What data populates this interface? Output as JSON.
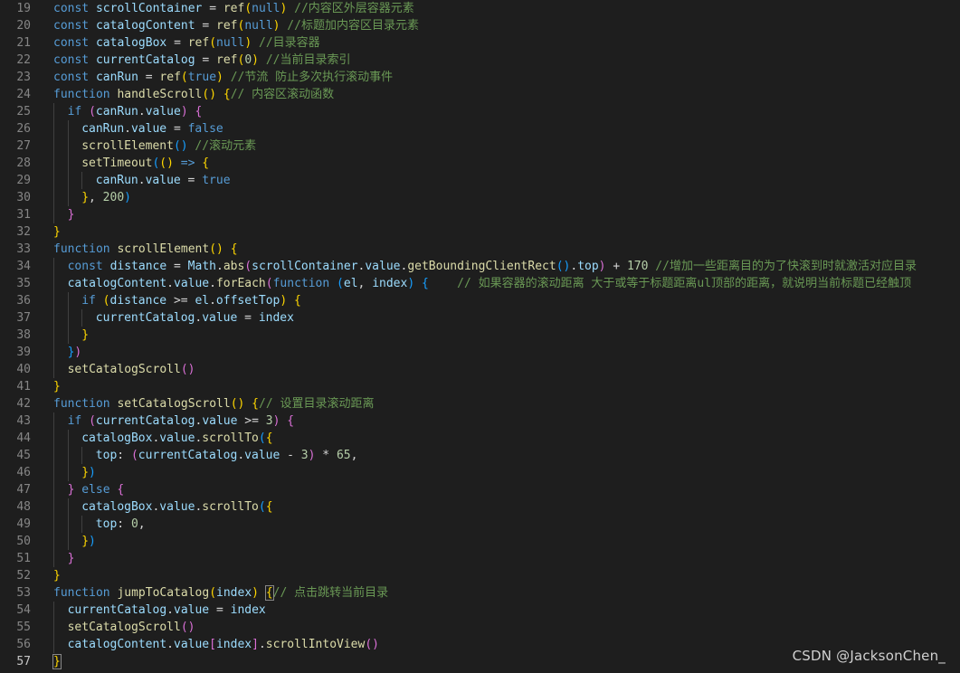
{
  "editor": {
    "current_line": 57,
    "lines": [
      {
        "n": 19,
        "indent": 0,
        "tokens": [
          [
            "kw",
            "const "
          ],
          [
            "var",
            "scrollContainer"
          ],
          [
            "op",
            " = "
          ],
          [
            "fn",
            "ref"
          ],
          [
            "b1",
            "("
          ],
          [
            "kw",
            "null"
          ],
          [
            "b1",
            ")"
          ],
          [
            "com",
            " //内容区外层容器元素"
          ]
        ]
      },
      {
        "n": 20,
        "indent": 0,
        "tokens": [
          [
            "kw",
            "const "
          ],
          [
            "var",
            "catalogContent"
          ],
          [
            "op",
            " = "
          ],
          [
            "fn",
            "ref"
          ],
          [
            "b1",
            "("
          ],
          [
            "kw",
            "null"
          ],
          [
            "b1",
            ")"
          ],
          [
            "com",
            " //标题加内容区目录元素"
          ]
        ]
      },
      {
        "n": 21,
        "indent": 0,
        "tokens": [
          [
            "kw",
            "const "
          ],
          [
            "var",
            "catalogBox"
          ],
          [
            "op",
            " = "
          ],
          [
            "fn",
            "ref"
          ],
          [
            "b1",
            "("
          ],
          [
            "kw",
            "null"
          ],
          [
            "b1",
            ")"
          ],
          [
            "com",
            " //目录容器"
          ]
        ]
      },
      {
        "n": 22,
        "indent": 0,
        "tokens": [
          [
            "kw",
            "const "
          ],
          [
            "var",
            "currentCatalog"
          ],
          [
            "op",
            " = "
          ],
          [
            "fn",
            "ref"
          ],
          [
            "b1",
            "("
          ],
          [
            "num",
            "0"
          ],
          [
            "b1",
            ")"
          ],
          [
            "com",
            " //当前目录索引"
          ]
        ]
      },
      {
        "n": 23,
        "indent": 0,
        "tokens": [
          [
            "kw",
            "const "
          ],
          [
            "var",
            "canRun"
          ],
          [
            "op",
            " = "
          ],
          [
            "fn",
            "ref"
          ],
          [
            "b1",
            "("
          ],
          [
            "kw",
            "true"
          ],
          [
            "b1",
            ")"
          ],
          [
            "com",
            " //节流 防止多次执行滚动事件"
          ]
        ]
      },
      {
        "n": 24,
        "indent": 0,
        "tokens": [
          [
            "kw",
            "function "
          ],
          [
            "fn",
            "handleScroll"
          ],
          [
            "b1",
            "()"
          ],
          [
            "op",
            " "
          ],
          [
            "b1",
            "{"
          ],
          [
            "com",
            "// 内容区滚动函数"
          ]
        ]
      },
      {
        "n": 25,
        "indent": 1,
        "tokens": [
          [
            "kw",
            "if "
          ],
          [
            "b2",
            "("
          ],
          [
            "var",
            "canRun"
          ],
          [
            "op",
            "."
          ],
          [
            "var",
            "value"
          ],
          [
            "b2",
            ")"
          ],
          [
            "op",
            " "
          ],
          [
            "b2",
            "{"
          ]
        ]
      },
      {
        "n": 26,
        "indent": 2,
        "tokens": [
          [
            "var",
            "canRun"
          ],
          [
            "op",
            "."
          ],
          [
            "var",
            "value"
          ],
          [
            "op",
            " = "
          ],
          [
            "kw",
            "false"
          ]
        ]
      },
      {
        "n": 27,
        "indent": 2,
        "tokens": [
          [
            "fn",
            "scrollElement"
          ],
          [
            "b3",
            "()"
          ],
          [
            "com",
            " //滚动元素"
          ]
        ]
      },
      {
        "n": 28,
        "indent": 2,
        "tokens": [
          [
            "fn",
            "setTimeout"
          ],
          [
            "b3",
            "("
          ],
          [
            "b1",
            "()"
          ],
          [
            "op",
            " "
          ],
          [
            "kw",
            "=>"
          ],
          [
            "op",
            " "
          ],
          [
            "b1",
            "{"
          ]
        ]
      },
      {
        "n": 29,
        "indent": 3,
        "tokens": [
          [
            "var",
            "canRun"
          ],
          [
            "op",
            "."
          ],
          [
            "var",
            "value"
          ],
          [
            "op",
            " = "
          ],
          [
            "kw",
            "true"
          ]
        ]
      },
      {
        "n": 30,
        "indent": 2,
        "tokens": [
          [
            "b1",
            "}"
          ],
          [
            "op",
            ", "
          ],
          [
            "num",
            "200"
          ],
          [
            "b3",
            ")"
          ]
        ]
      },
      {
        "n": 31,
        "indent": 1,
        "tokens": [
          [
            "b2",
            "}"
          ]
        ]
      },
      {
        "n": 32,
        "indent": 0,
        "tokens": [
          [
            "b1",
            "}"
          ]
        ]
      },
      {
        "n": 33,
        "indent": 0,
        "tokens": [
          [
            "kw",
            "function "
          ],
          [
            "fn",
            "scrollElement"
          ],
          [
            "b1",
            "()"
          ],
          [
            "op",
            " "
          ],
          [
            "b1",
            "{"
          ]
        ]
      },
      {
        "n": 34,
        "indent": 1,
        "tokens": [
          [
            "kw",
            "const "
          ],
          [
            "var",
            "distance"
          ],
          [
            "op",
            " = "
          ],
          [
            "var",
            "Math"
          ],
          [
            "op",
            "."
          ],
          [
            "fn",
            "abs"
          ],
          [
            "b2",
            "("
          ],
          [
            "var",
            "scrollContainer"
          ],
          [
            "op",
            "."
          ],
          [
            "var",
            "value"
          ],
          [
            "op",
            "."
          ],
          [
            "fn",
            "getBoundingClientRect"
          ],
          [
            "b3",
            "()"
          ],
          [
            "op",
            "."
          ],
          [
            "var",
            "top"
          ],
          [
            "b2",
            ")"
          ],
          [
            "op",
            " + "
          ],
          [
            "num",
            "170"
          ],
          [
            "com",
            " //增加一些距离目的为了快滚到时就激活对应目录"
          ]
        ]
      },
      {
        "n": 35,
        "indent": 1,
        "tokens": [
          [
            "var",
            "catalogContent"
          ],
          [
            "op",
            "."
          ],
          [
            "var",
            "value"
          ],
          [
            "op",
            "."
          ],
          [
            "fn",
            "forEach"
          ],
          [
            "b2",
            "("
          ],
          [
            "kw",
            "function "
          ],
          [
            "b3",
            "("
          ],
          [
            "var",
            "el"
          ],
          [
            "op",
            ", "
          ],
          [
            "var",
            "index"
          ],
          [
            "b3",
            ")"
          ],
          [
            "op",
            " "
          ],
          [
            "b3",
            "{"
          ],
          [
            "com",
            "    // 如果容器的滚动距离 大于或等于标题距离ul顶部的距离，就说明当前标题已经触顶"
          ]
        ]
      },
      {
        "n": 36,
        "indent": 2,
        "tokens": [
          [
            "kw",
            "if "
          ],
          [
            "b1",
            "("
          ],
          [
            "var",
            "distance"
          ],
          [
            "op",
            " >= "
          ],
          [
            "var",
            "el"
          ],
          [
            "op",
            "."
          ],
          [
            "var",
            "offsetTop"
          ],
          [
            "b1",
            ")"
          ],
          [
            "op",
            " "
          ],
          [
            "b1",
            "{"
          ]
        ]
      },
      {
        "n": 37,
        "indent": 3,
        "tokens": [
          [
            "var",
            "currentCatalog"
          ],
          [
            "op",
            "."
          ],
          [
            "var",
            "value"
          ],
          [
            "op",
            " = "
          ],
          [
            "var",
            "index"
          ]
        ]
      },
      {
        "n": 38,
        "indent": 2,
        "tokens": [
          [
            "b1",
            "}"
          ]
        ]
      },
      {
        "n": 39,
        "indent": 1,
        "tokens": [
          [
            "b3",
            "}"
          ],
          [
            "b2",
            ")"
          ]
        ]
      },
      {
        "n": 40,
        "indent": 1,
        "tokens": [
          [
            "fn",
            "setCatalogScroll"
          ],
          [
            "b2",
            "()"
          ]
        ]
      },
      {
        "n": 41,
        "indent": 0,
        "tokens": [
          [
            "b1",
            "}"
          ]
        ]
      },
      {
        "n": 42,
        "indent": 0,
        "tokens": [
          [
            "kw",
            "function "
          ],
          [
            "fn",
            "setCatalogScroll"
          ],
          [
            "b1",
            "()"
          ],
          [
            "op",
            " "
          ],
          [
            "b1",
            "{"
          ],
          [
            "com",
            "// 设置目录滚动距离"
          ]
        ]
      },
      {
        "n": 43,
        "indent": 1,
        "tokens": [
          [
            "kw",
            "if "
          ],
          [
            "b2",
            "("
          ],
          [
            "var",
            "currentCatalog"
          ],
          [
            "op",
            "."
          ],
          [
            "var",
            "value"
          ],
          [
            "op",
            " >= "
          ],
          [
            "num",
            "3"
          ],
          [
            "b2",
            ")"
          ],
          [
            "op",
            " "
          ],
          [
            "b2",
            "{"
          ]
        ]
      },
      {
        "n": 44,
        "indent": 2,
        "tokens": [
          [
            "var",
            "catalogBox"
          ],
          [
            "op",
            "."
          ],
          [
            "var",
            "value"
          ],
          [
            "op",
            "."
          ],
          [
            "fn",
            "scrollTo"
          ],
          [
            "b3",
            "("
          ],
          [
            "b1",
            "{"
          ]
        ]
      },
      {
        "n": 45,
        "indent": 3,
        "tokens": [
          [
            "var",
            "top"
          ],
          [
            "op",
            ": "
          ],
          [
            "b2",
            "("
          ],
          [
            "var",
            "currentCatalog"
          ],
          [
            "op",
            "."
          ],
          [
            "var",
            "value"
          ],
          [
            "op",
            " - "
          ],
          [
            "num",
            "3"
          ],
          [
            "b2",
            ")"
          ],
          [
            "op",
            " * "
          ],
          [
            "num",
            "65"
          ],
          [
            "op",
            ","
          ]
        ]
      },
      {
        "n": 46,
        "indent": 2,
        "tokens": [
          [
            "b1",
            "}"
          ],
          [
            "b3",
            ")"
          ]
        ]
      },
      {
        "n": 47,
        "indent": 1,
        "tokens": [
          [
            "b2",
            "}"
          ],
          [
            "op",
            " "
          ],
          [
            "kw",
            "else "
          ],
          [
            "b2",
            "{"
          ]
        ]
      },
      {
        "n": 48,
        "indent": 2,
        "tokens": [
          [
            "var",
            "catalogBox"
          ],
          [
            "op",
            "."
          ],
          [
            "var",
            "value"
          ],
          [
            "op",
            "."
          ],
          [
            "fn",
            "scrollTo"
          ],
          [
            "b3",
            "("
          ],
          [
            "b1",
            "{"
          ]
        ]
      },
      {
        "n": 49,
        "indent": 3,
        "tokens": [
          [
            "var",
            "top"
          ],
          [
            "op",
            ": "
          ],
          [
            "num",
            "0"
          ],
          [
            "op",
            ","
          ]
        ]
      },
      {
        "n": 50,
        "indent": 2,
        "tokens": [
          [
            "b1",
            "}"
          ],
          [
            "b3",
            ")"
          ]
        ]
      },
      {
        "n": 51,
        "indent": 1,
        "tokens": [
          [
            "b2",
            "}"
          ]
        ]
      },
      {
        "n": 52,
        "indent": 0,
        "tokens": [
          [
            "b1",
            "}"
          ]
        ]
      },
      {
        "n": 53,
        "indent": 0,
        "tokens": [
          [
            "kw",
            "function "
          ],
          [
            "fn",
            "jumpToCatalog"
          ],
          [
            "b1",
            "("
          ],
          [
            "var",
            "index"
          ],
          [
            "b1",
            ")"
          ],
          [
            "op",
            " "
          ],
          [
            "b1 bm",
            "{"
          ],
          [
            "com",
            "// 点击跳转当前目录"
          ]
        ]
      },
      {
        "n": 54,
        "indent": 1,
        "tokens": [
          [
            "var",
            "currentCatalog"
          ],
          [
            "op",
            "."
          ],
          [
            "var",
            "value"
          ],
          [
            "op",
            " = "
          ],
          [
            "var",
            "index"
          ]
        ]
      },
      {
        "n": 55,
        "indent": 1,
        "tokens": [
          [
            "fn",
            "setCatalogScroll"
          ],
          [
            "b2",
            "()"
          ]
        ]
      },
      {
        "n": 56,
        "indent": 1,
        "tokens": [
          [
            "var",
            "catalogContent"
          ],
          [
            "op",
            "."
          ],
          [
            "var",
            "value"
          ],
          [
            "b2",
            "["
          ],
          [
            "var",
            "index"
          ],
          [
            "b2",
            "]"
          ],
          [
            "op",
            "."
          ],
          [
            "fn",
            "scrollIntoView"
          ],
          [
            "b2",
            "()"
          ]
        ]
      },
      {
        "n": 57,
        "indent": 0,
        "tokens": [
          [
            "b1 bm",
            "}"
          ]
        ]
      }
    ]
  },
  "watermark": "CSDN @JacksonChen_"
}
